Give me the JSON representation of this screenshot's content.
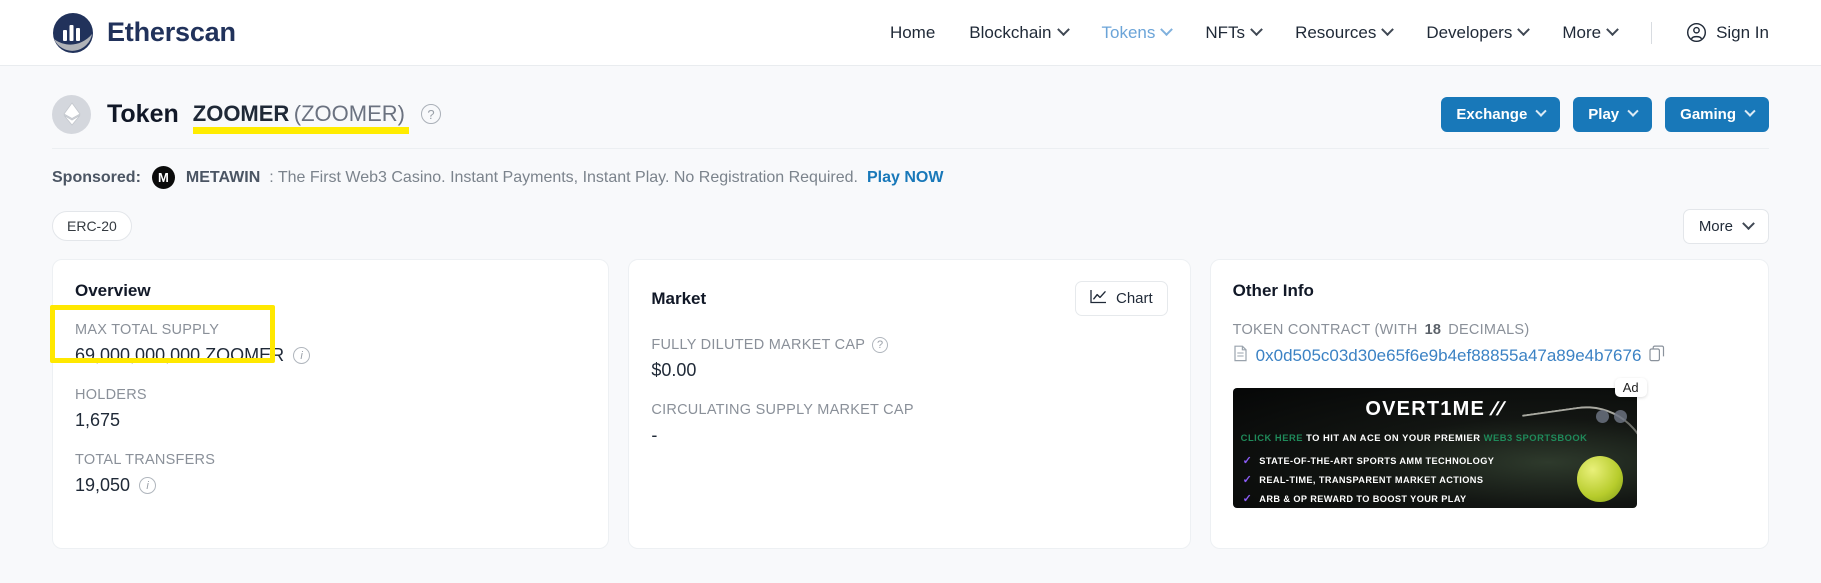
{
  "brand": {
    "name": "Etherscan"
  },
  "nav": {
    "items": [
      {
        "label": "Home",
        "dropdown": false,
        "active": false
      },
      {
        "label": "Blockchain",
        "dropdown": true,
        "active": false
      },
      {
        "label": "Tokens",
        "dropdown": true,
        "active": true
      },
      {
        "label": "NFTs",
        "dropdown": true,
        "active": false
      },
      {
        "label": "Resources",
        "dropdown": true,
        "active": false
      },
      {
        "label": "Developers",
        "dropdown": true,
        "active": false
      },
      {
        "label": "More",
        "dropdown": true,
        "active": false
      }
    ],
    "sign_in": "Sign In",
    "sign_in_icon": "person-circle-icon"
  },
  "token_header": {
    "eth_icon": "ethereum-diamond-icon",
    "prefix": "Token",
    "name": "ZOOMER",
    "symbol": "(ZOOMER)",
    "help_icon": "question-mark-icon",
    "buttons": [
      {
        "label": "Exchange"
      },
      {
        "label": "Play"
      },
      {
        "label": "Gaming"
      }
    ]
  },
  "sponsored": {
    "label": "Sponsored:",
    "advertiser_icon": "metawin-logo-icon",
    "advertiser_glyph": "M",
    "advertiser": "METAWIN",
    "text": ": The First Web3 Casino. Instant Payments, Instant Play. No Registration Required.",
    "cta": "Play NOW"
  },
  "badge_row": {
    "token_standard": "ERC-20",
    "more_label": "More"
  },
  "cards": {
    "overview": {
      "title": "Overview",
      "fields": [
        {
          "label": "MAX TOTAL SUPPLY",
          "value": "69,000,000,000 ZOOMER",
          "info": true
        },
        {
          "label": "HOLDERS",
          "value": "1,675",
          "info": false
        },
        {
          "label": "TOTAL TRANSFERS",
          "value": "19,050",
          "info": true
        }
      ]
    },
    "market": {
      "title": "Market",
      "chart_button": "Chart",
      "chart_icon": "line-chart-icon",
      "fields": [
        {
          "label": "FULLY DILUTED MARKET CAP",
          "help": true,
          "value": "$0.00"
        },
        {
          "label": "CIRCULATING SUPPLY MARKET CAP",
          "help": false,
          "value": "-"
        }
      ]
    },
    "other_info": {
      "title": "Other Info",
      "contract_label_pre": "TOKEN CONTRACT (WITH ",
      "contract_decimals": "18",
      "contract_label_post": " DECIMALS)",
      "contract_address": "0x0d505c03d30e65f6e9b4ef88855a47a89e4b7676",
      "doc_icon": "document-icon",
      "copy_icon": "copy-icon",
      "ad": {
        "badge": "Ad",
        "logo": "OVERT1ME",
        "tagline_green_1": "CLICK HERE",
        "tagline_white": " TO HIT AN ACE ON YOUR PREMIER ",
        "tagline_green_2": "WEB3 SPORTSBOOK",
        "bullets": [
          "STATE-OF-THE-ART SPORTS AMM TECHNOLOGY",
          "REAL-TIME, TRANSPARENT MARKET ACTIONS",
          "ARB & OP REWARD TO BOOST YOUR PLAY"
        ]
      }
    }
  },
  "colors": {
    "brand_navy": "#21325b",
    "accent_blue": "#1878b9",
    "link_blue": "#3b82c4",
    "active_nav": "#6ba4d8",
    "highlight_yellow": "#ffe800",
    "page_bg": "#f8f9fb"
  }
}
